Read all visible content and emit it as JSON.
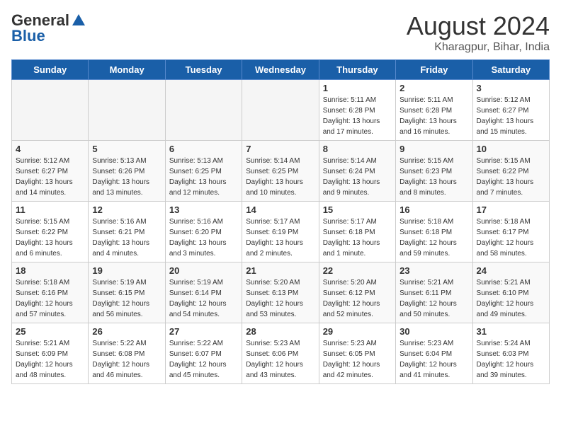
{
  "header": {
    "logo_line1": "General",
    "logo_line2": "Blue",
    "main_title": "August 2024",
    "subtitle": "Kharagpur, Bihar, India"
  },
  "days_of_week": [
    "Sunday",
    "Monday",
    "Tuesday",
    "Wednesday",
    "Thursday",
    "Friday",
    "Saturday"
  ],
  "weeks": [
    [
      {
        "day": "",
        "empty": true
      },
      {
        "day": "",
        "empty": true
      },
      {
        "day": "",
        "empty": true
      },
      {
        "day": "",
        "empty": true
      },
      {
        "day": "1",
        "info": "Sunrise: 5:11 AM\nSunset: 6:28 PM\nDaylight: 13 hours\nand 17 minutes."
      },
      {
        "day": "2",
        "info": "Sunrise: 5:11 AM\nSunset: 6:28 PM\nDaylight: 13 hours\nand 16 minutes."
      },
      {
        "day": "3",
        "info": "Sunrise: 5:12 AM\nSunset: 6:27 PM\nDaylight: 13 hours\nand 15 minutes."
      }
    ],
    [
      {
        "day": "4",
        "info": "Sunrise: 5:12 AM\nSunset: 6:27 PM\nDaylight: 13 hours\nand 14 minutes."
      },
      {
        "day": "5",
        "info": "Sunrise: 5:13 AM\nSunset: 6:26 PM\nDaylight: 13 hours\nand 13 minutes."
      },
      {
        "day": "6",
        "info": "Sunrise: 5:13 AM\nSunset: 6:25 PM\nDaylight: 13 hours\nand 12 minutes."
      },
      {
        "day": "7",
        "info": "Sunrise: 5:14 AM\nSunset: 6:25 PM\nDaylight: 13 hours\nand 10 minutes."
      },
      {
        "day": "8",
        "info": "Sunrise: 5:14 AM\nSunset: 6:24 PM\nDaylight: 13 hours\nand 9 minutes."
      },
      {
        "day": "9",
        "info": "Sunrise: 5:15 AM\nSunset: 6:23 PM\nDaylight: 13 hours\nand 8 minutes."
      },
      {
        "day": "10",
        "info": "Sunrise: 5:15 AM\nSunset: 6:22 PM\nDaylight: 13 hours\nand 7 minutes."
      }
    ],
    [
      {
        "day": "11",
        "info": "Sunrise: 5:15 AM\nSunset: 6:22 PM\nDaylight: 13 hours\nand 6 minutes."
      },
      {
        "day": "12",
        "info": "Sunrise: 5:16 AM\nSunset: 6:21 PM\nDaylight: 13 hours\nand 4 minutes."
      },
      {
        "day": "13",
        "info": "Sunrise: 5:16 AM\nSunset: 6:20 PM\nDaylight: 13 hours\nand 3 minutes."
      },
      {
        "day": "14",
        "info": "Sunrise: 5:17 AM\nSunset: 6:19 PM\nDaylight: 13 hours\nand 2 minutes."
      },
      {
        "day": "15",
        "info": "Sunrise: 5:17 AM\nSunset: 6:18 PM\nDaylight: 13 hours\nand 1 minute."
      },
      {
        "day": "16",
        "info": "Sunrise: 5:18 AM\nSunset: 6:18 PM\nDaylight: 12 hours\nand 59 minutes."
      },
      {
        "day": "17",
        "info": "Sunrise: 5:18 AM\nSunset: 6:17 PM\nDaylight: 12 hours\nand 58 minutes."
      }
    ],
    [
      {
        "day": "18",
        "info": "Sunrise: 5:18 AM\nSunset: 6:16 PM\nDaylight: 12 hours\nand 57 minutes."
      },
      {
        "day": "19",
        "info": "Sunrise: 5:19 AM\nSunset: 6:15 PM\nDaylight: 12 hours\nand 56 minutes."
      },
      {
        "day": "20",
        "info": "Sunrise: 5:19 AM\nSunset: 6:14 PM\nDaylight: 12 hours\nand 54 minutes."
      },
      {
        "day": "21",
        "info": "Sunrise: 5:20 AM\nSunset: 6:13 PM\nDaylight: 12 hours\nand 53 minutes."
      },
      {
        "day": "22",
        "info": "Sunrise: 5:20 AM\nSunset: 6:12 PM\nDaylight: 12 hours\nand 52 minutes."
      },
      {
        "day": "23",
        "info": "Sunrise: 5:21 AM\nSunset: 6:11 PM\nDaylight: 12 hours\nand 50 minutes."
      },
      {
        "day": "24",
        "info": "Sunrise: 5:21 AM\nSunset: 6:10 PM\nDaylight: 12 hours\nand 49 minutes."
      }
    ],
    [
      {
        "day": "25",
        "info": "Sunrise: 5:21 AM\nSunset: 6:09 PM\nDaylight: 12 hours\nand 48 minutes."
      },
      {
        "day": "26",
        "info": "Sunrise: 5:22 AM\nSunset: 6:08 PM\nDaylight: 12 hours\nand 46 minutes."
      },
      {
        "day": "27",
        "info": "Sunrise: 5:22 AM\nSunset: 6:07 PM\nDaylight: 12 hours\nand 45 minutes."
      },
      {
        "day": "28",
        "info": "Sunrise: 5:23 AM\nSunset: 6:06 PM\nDaylight: 12 hours\nand 43 minutes."
      },
      {
        "day": "29",
        "info": "Sunrise: 5:23 AM\nSunset: 6:05 PM\nDaylight: 12 hours\nand 42 minutes."
      },
      {
        "day": "30",
        "info": "Sunrise: 5:23 AM\nSunset: 6:04 PM\nDaylight: 12 hours\nand 41 minutes."
      },
      {
        "day": "31",
        "info": "Sunrise: 5:24 AM\nSunset: 6:03 PM\nDaylight: 12 hours\nand 39 minutes."
      }
    ]
  ]
}
